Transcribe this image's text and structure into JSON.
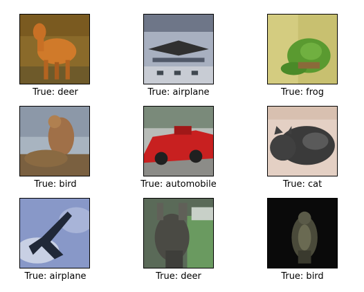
{
  "grid": {
    "items": [
      {
        "label": "True: deer"
      },
      {
        "label": "True: airplane"
      },
      {
        "label": "True: frog"
      },
      {
        "label": "True: bird"
      },
      {
        "label": "True: automobile"
      },
      {
        "label": "True: cat"
      },
      {
        "label": "True: airplane"
      },
      {
        "label": "True: deer"
      },
      {
        "label": "True: bird"
      }
    ]
  }
}
